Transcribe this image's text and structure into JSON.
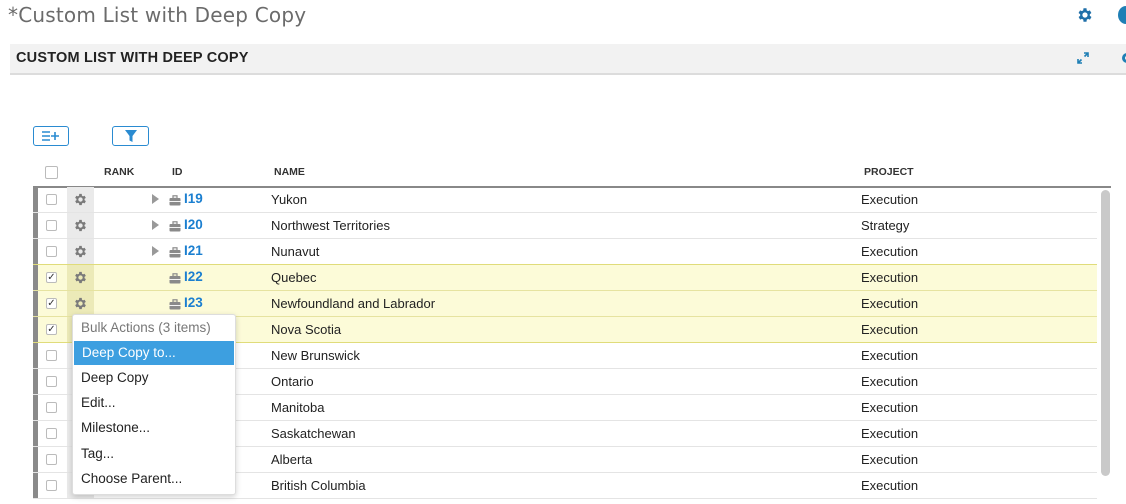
{
  "page": {
    "title": "*Custom List with Deep Copy"
  },
  "panel": {
    "title": "CUSTOM LIST WITH DEEP COPY"
  },
  "icons": {
    "settings": "gear-icon",
    "expand": "expand-icon",
    "add_row": "add-list-icon",
    "filter": "filter-icon",
    "briefcase": "briefcase-icon",
    "expander": "caret-right-icon"
  },
  "colors": {
    "accent": "#1b7fd0",
    "selected_row": "#fcfbd8",
    "menu_highlight": "#3d9fe0"
  },
  "grid": {
    "columns": {
      "rank": "RANK",
      "id": "ID",
      "name": "NAME",
      "project": "PROJECT"
    },
    "rows": [
      {
        "id": "I19",
        "name": "Yukon",
        "project": "Execution",
        "checked": false,
        "expandable": true
      },
      {
        "id": "I20",
        "name": "Northwest Territories",
        "project": "Strategy",
        "checked": false,
        "expandable": true
      },
      {
        "id": "I21",
        "name": "Nunavut",
        "project": "Execution",
        "checked": false,
        "expandable": true
      },
      {
        "id": "I22",
        "name": "Quebec",
        "project": "Execution",
        "checked": true,
        "expandable": false
      },
      {
        "id": "I23",
        "name": "Newfoundland and Labrador",
        "project": "Execution",
        "checked": true,
        "expandable": false
      },
      {
        "id": "",
        "name": "Nova Scotia",
        "project": "Execution",
        "checked": true,
        "expandable": false
      },
      {
        "id": "",
        "name": "New Brunswick",
        "project": "Execution",
        "checked": false,
        "expandable": false
      },
      {
        "id": "",
        "name": "Ontario",
        "project": "Execution",
        "checked": false,
        "expandable": false
      },
      {
        "id": "",
        "name": "Manitoba",
        "project": "Execution",
        "checked": false,
        "expandable": false
      },
      {
        "id": "",
        "name": "Saskatchewan",
        "project": "Execution",
        "checked": false,
        "expandable": false
      },
      {
        "id": "",
        "name": "Alberta",
        "project": "Execution",
        "checked": false,
        "expandable": false
      },
      {
        "id": "",
        "name": "British Columbia",
        "project": "Execution",
        "checked": false,
        "expandable": false
      }
    ]
  },
  "context_menu": {
    "header": "Bulk Actions (3 items)",
    "items": [
      "Deep Copy to...",
      "Deep Copy",
      "Edit...",
      "Milestone...",
      "Tag...",
      "Choose Parent..."
    ],
    "highlighted": "Deep Copy to..."
  }
}
